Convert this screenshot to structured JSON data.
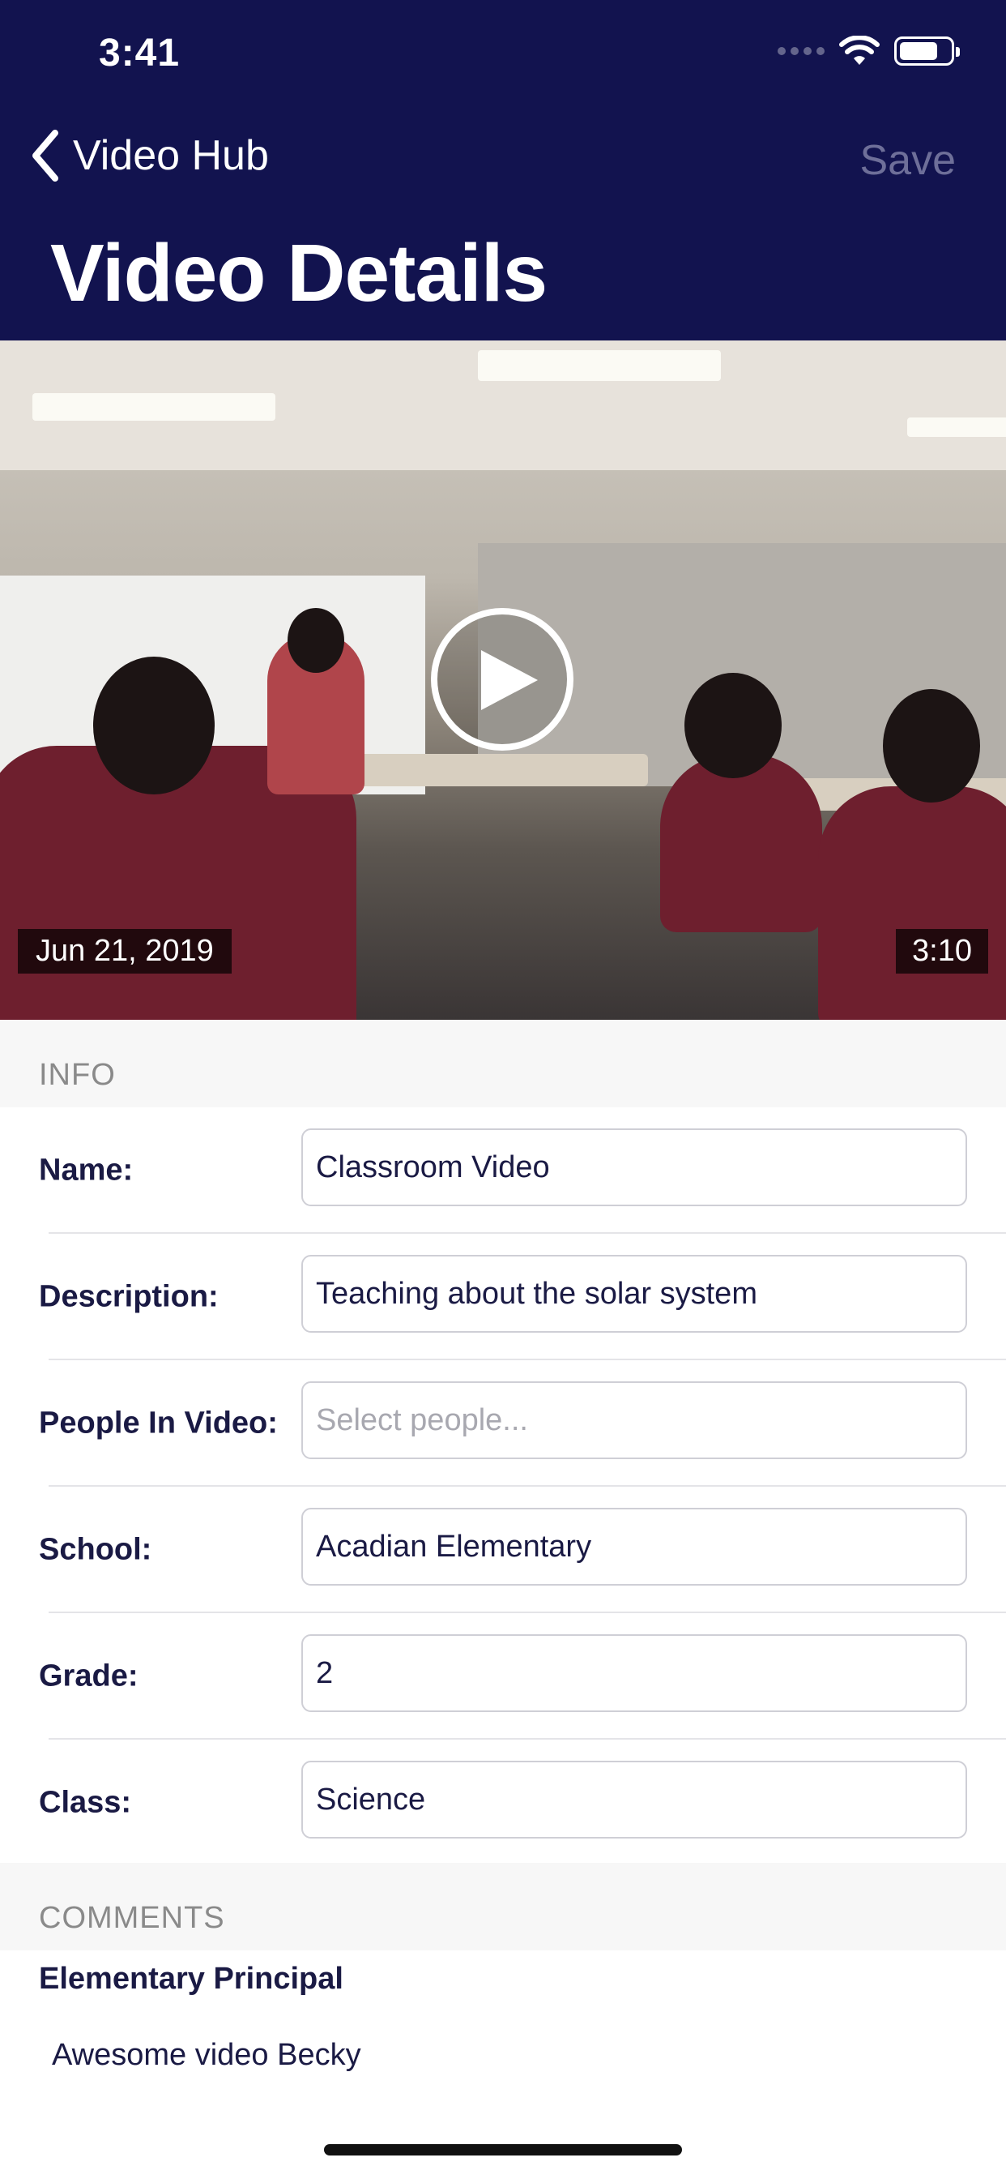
{
  "status_bar": {
    "time": "3:41"
  },
  "nav": {
    "back_label": "Video Hub",
    "save_label": "Save",
    "title": "Video Details"
  },
  "video": {
    "date": "Jun 21, 2019",
    "duration": "3:10"
  },
  "info": {
    "section_label": "INFO",
    "fields": [
      {
        "label": "Name:",
        "value": "Classroom Video",
        "placeholder": ""
      },
      {
        "label": "Description:",
        "value": "Teaching about the solar system",
        "placeholder": ""
      },
      {
        "label": "People In Video:",
        "value": "",
        "placeholder": "Select people..."
      },
      {
        "label": "School:",
        "value": "Acadian Elementary",
        "placeholder": ""
      },
      {
        "label": "Grade:",
        "value": "2",
        "placeholder": ""
      },
      {
        "label": "Class:",
        "value": "Science",
        "placeholder": ""
      }
    ]
  },
  "comments": {
    "section_label": "COMMENTS",
    "items": [
      {
        "author": "Elementary Principal",
        "text": "Awesome video Becky"
      }
    ]
  },
  "colors": {
    "header_bg": "#12134f",
    "save_disabled": "#6e6f99",
    "text_primary": "#1a1a44"
  }
}
